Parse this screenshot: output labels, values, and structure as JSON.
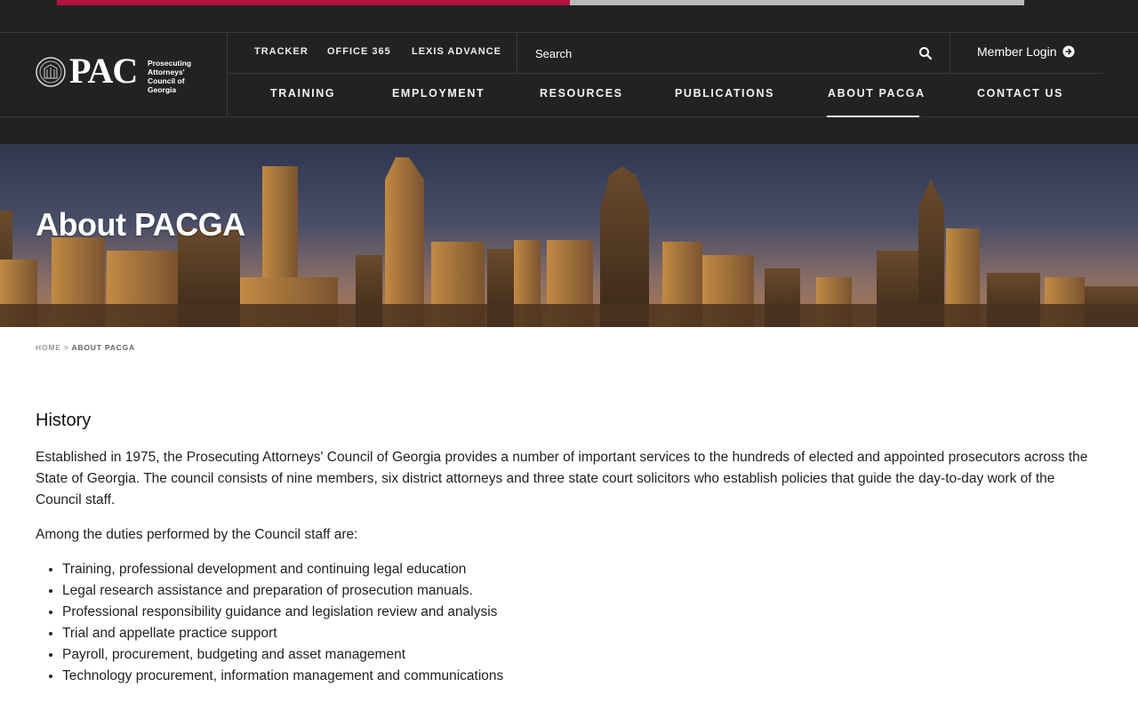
{
  "progress": {
    "fraction": 0.53
  },
  "logo": {
    "wordmark": "PAC",
    "subtitle": "Prosecuting\nAttorneys'\nCouncil of Georgia"
  },
  "utility_nav": {
    "tracker": "TRACKER",
    "office365": "OFFICE 365",
    "lexis": "LEXIS ADVANCE"
  },
  "search": {
    "label": "Search",
    "icon": "search-icon"
  },
  "member_login": {
    "label": "Member Login",
    "icon": "arrow-circle-right-icon"
  },
  "main_nav": {
    "items": [
      "TRAINING",
      "EMPLOYMENT",
      "RESOURCES",
      "PUBLICATIONS",
      "ABOUT PACGA",
      "CONTACT US"
    ],
    "active": "ABOUT PACGA"
  },
  "hero": {
    "title": "About PACGA"
  },
  "breadcrumb": {
    "home": "HOME",
    "separator": ">",
    "current": "ABOUT PACGA"
  },
  "content": {
    "heading": "History",
    "paragraph1": "Established in 1975, the Prosecuting Attorneys' Council of Georgia provides a number of important services to the hundreds of elected and appointed prosecutors across the State of Georgia. The council consists of nine members, six district attorneys and three state court solicitors who establish policies that guide the day-to-day work of the Council staff.",
    "paragraph2": "Among the duties performed by the Council staff are:",
    "duties": [
      "Training, professional development and continuing legal education",
      "Legal research assistance and preparation of prosecution manuals.",
      "Professional responsibility guidance and legislation review and analysis",
      "Trial and appellate practice support",
      "Payroll, procurement, budgeting and asset management",
      "Technology procurement, information management and communications"
    ]
  },
  "colors": {
    "header_bg": "#222222",
    "accent": "#b0143e",
    "track": "#b9b9b9"
  }
}
